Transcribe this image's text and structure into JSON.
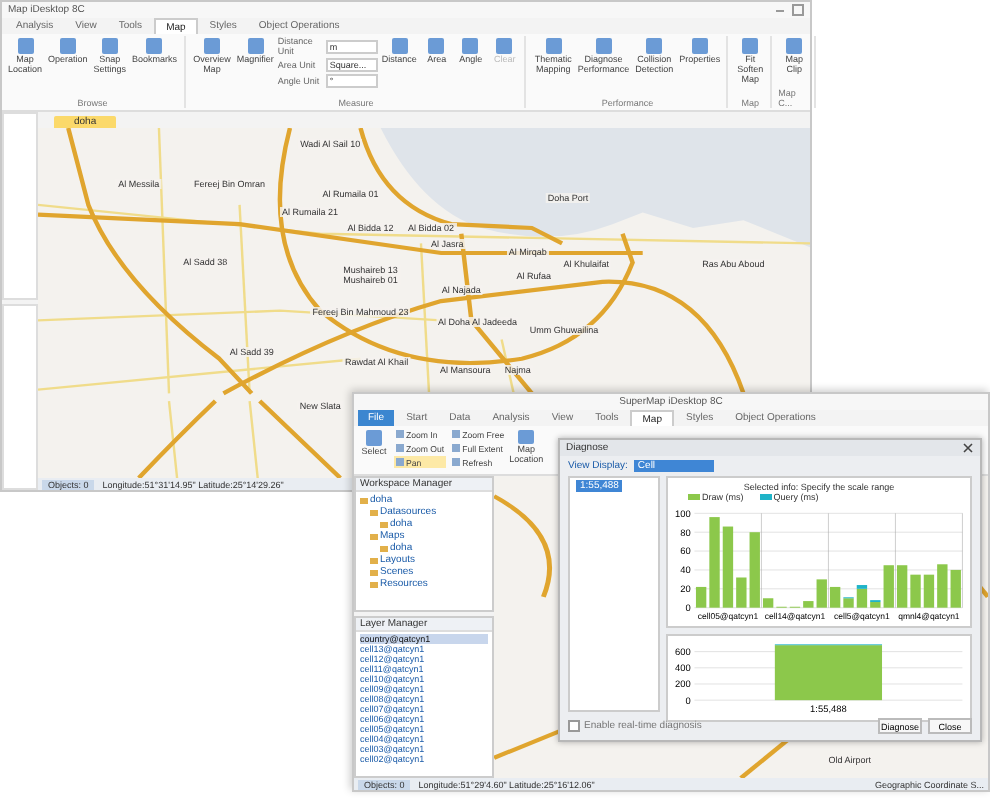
{
  "back_window": {
    "title": "Map iDesktop 8C",
    "tabs": [
      {
        "label": "Analysis",
        "selected": false
      },
      {
        "label": "View",
        "selected": false
      },
      {
        "label": "Tools",
        "selected": false
      },
      {
        "label": "Map",
        "selected": true
      },
      {
        "label": "Styles",
        "selected": false
      },
      {
        "label": "Object Operations",
        "selected": false
      }
    ],
    "ribbon_groups": [
      {
        "label": "Browse",
        "items": [
          {
            "kind": "button",
            "label": "Map Location",
            "disabled": false
          },
          {
            "kind": "button",
            "label": "Operation",
            "disabled": false
          },
          {
            "kind": "button",
            "label": "Snap Settings",
            "disabled": false
          },
          {
            "kind": "button",
            "label": "Bookmarks",
            "disabled": false
          }
        ]
      },
      {
        "label": "Measure",
        "items": [
          {
            "kind": "button",
            "label": "Overview Map",
            "disabled": false
          },
          {
            "kind": "button",
            "label": "Magnifier",
            "disabled": false
          },
          {
            "kind": "units",
            "fields": [
              {
                "label": "Distance Unit",
                "value": "m"
              },
              {
                "label": "Area Unit",
                "value": "Square..."
              },
              {
                "label": "Angle Unit",
                "value": "°"
              }
            ]
          },
          {
            "kind": "button",
            "label": "Distance",
            "disabled": false
          },
          {
            "kind": "button",
            "label": "Area",
            "disabled": false
          },
          {
            "kind": "button",
            "label": "Angle",
            "disabled": false
          },
          {
            "kind": "button",
            "label": "Clear",
            "disabled": true
          }
        ]
      },
      {
        "label": "Performance",
        "items": [
          {
            "kind": "button",
            "label": "Thematic Mapping",
            "disabled": false
          },
          {
            "kind": "button",
            "label": "Diagnose Performance",
            "disabled": false
          },
          {
            "kind": "button",
            "label": "Collision Detection",
            "disabled": false
          },
          {
            "kind": "button",
            "label": "Properties",
            "disabled": false
          }
        ]
      },
      {
        "label": "Map",
        "items": [
          {
            "kind": "button",
            "label": "Fit Soften Map",
            "disabled": false
          }
        ]
      },
      {
        "label": "Map C...",
        "items": [
          {
            "kind": "button",
            "label": "Map Clip",
            "disabled": false
          }
        ]
      }
    ],
    "document_tab": "doha",
    "map_labels": [
      "Wadi Al Sail 10",
      "Al Messila",
      "Fereej Bin Omran",
      "Al Rumaila 01",
      "Doha Port",
      "Al Rumaila 21",
      "Al Bidda 12",
      "Al Bidda 02",
      "Al Jasra",
      "Al Mirqab",
      "Al Sadd 38",
      "Al Khulaifat",
      "Ras Abu Aboud",
      "Mushaireb 13",
      "Al Rufaa",
      "Mushaireb 01",
      "Al Najada",
      "Fereej Bin Mahmoud 23",
      "Al Doha Al Jadeeda",
      "Umm Ghuwailina",
      "Al Sadd 39",
      "Rawdat Al Khail",
      "Al Mansoura",
      "Najma",
      "New Slata"
    ],
    "status_bar": {
      "objects": "Objects: 0",
      "coordinates": "Longitude:51°31'14.95\"  Latitude:25°14'29.26\""
    }
  },
  "front_window": {
    "title": "SuperMap iDesktop 8C",
    "tabs": [
      {
        "label": "File",
        "selected": false,
        "kind": "file"
      },
      {
        "label": "Start",
        "selected": false,
        "kind": "tab"
      },
      {
        "label": "Data",
        "selected": false,
        "kind": "tab"
      },
      {
        "label": "Analysis",
        "selected": false,
        "kind": "tab"
      },
      {
        "label": "View",
        "selected": false,
        "kind": "tab"
      },
      {
        "label": "Tools",
        "selected": false,
        "kind": "tab"
      },
      {
        "label": "Map",
        "selected": true,
        "kind": "tab"
      },
      {
        "label": "Styles",
        "selected": false,
        "kind": "tab"
      },
      {
        "label": "Object Operations",
        "selected": false,
        "kind": "tab"
      }
    ],
    "ribbon": [
      {
        "kind": "large",
        "label": "Select",
        "selected": false
      },
      {
        "kind": "small",
        "label": "Zoom In",
        "selected": false
      },
      {
        "kind": "small",
        "label": "Zoom Out",
        "selected": false
      },
      {
        "kind": "small",
        "label": "Pan",
        "selected": true
      },
      {
        "kind": "small",
        "label": "Zoom Free",
        "selected": false
      },
      {
        "kind": "small",
        "label": "Full Extent",
        "selected": false
      },
      {
        "kind": "small",
        "label": "Refresh",
        "selected": false
      },
      {
        "kind": "large",
        "label": "Map Location",
        "selected": false
      }
    ],
    "workspace_manager": {
      "title": "Workspace Manager",
      "tree": [
        {
          "label": "doha",
          "children": [
            {
              "label": "Datasources",
              "children": [
                {
                  "label": "doha"
                }
              ]
            },
            {
              "label": "Maps",
              "children": [
                {
                  "label": "doha"
                }
              ]
            },
            {
              "label": "Layouts"
            },
            {
              "label": "Scenes"
            },
            {
              "label": "Resources"
            }
          ]
        }
      ]
    },
    "layer_manager": {
      "title": "Layer Manager",
      "layers": [
        {
          "name": "country@qatcyn1",
          "selected": true
        },
        {
          "name": "cell13@qatcyn1",
          "selected": false
        },
        {
          "name": "cell12@qatcyn1",
          "selected": false
        },
        {
          "name": "cell11@qatcyn1",
          "selected": false
        },
        {
          "name": "cell10@qatcyn1",
          "selected": false
        },
        {
          "name": "cell09@qatcyn1",
          "selected": false
        },
        {
          "name": "cell08@qatcyn1",
          "selected": false
        },
        {
          "name": "cell07@qatcyn1",
          "selected": false
        },
        {
          "name": "cell06@qatcyn1",
          "selected": false
        },
        {
          "name": "cell05@qatcyn1",
          "selected": false
        },
        {
          "name": "cell04@qatcyn1",
          "selected": false
        },
        {
          "name": "cell03@qatcyn1",
          "selected": false
        },
        {
          "name": "cell02@qatcyn1",
          "selected": false
        }
      ]
    },
    "map_labels": [
      "Old Airport"
    ],
    "status_bar": {
      "objects": "Objects: 0",
      "coordinates": "Longitude:51°29'4.60\"  Latitude:25°16'12.06\"",
      "crs": "Geographic Coordinate S..."
    },
    "dialog": {
      "title": "Diagnose",
      "view_display_label": "View Display:",
      "view_display_value": "Cell",
      "tree_item": "1:55,488",
      "charts": [
        {
          "chart_data": {
            "type": "bar",
            "title": "Selected info: Specify the scale range",
            "stacked": true,
            "grid": true,
            "legend": "top-left",
            "categories": [
              null,
              null,
              "cell05@qatcyn1",
              null,
              null,
              null,
              null,
              "cell14@qatcyn1",
              null,
              null,
              null,
              null,
              "cell5@qatcyn1",
              null,
              null,
              null,
              null,
              "qmnl4@qatcyn1",
              null,
              null
            ],
            "yticks": [
              0,
              20,
              40,
              60,
              80,
              100
            ],
            "ylim": [
              0,
              100
            ],
            "series": [
              {
                "name": "Draw (ms)",
                "color": "#8cc84b",
                "values": [
                  22,
                  96,
                  86,
                  32,
                  80,
                  10,
                  1,
                  1,
                  7,
                  30,
                  22,
                  10,
                  20,
                  6,
                  45,
                  45,
                  35,
                  35,
                  46,
                  40
                ]
              },
              {
                "name": "Query (ms)",
                "color": "#1fb4c8",
                "values": [
                  0,
                  0,
                  0,
                  0,
                  0,
                  0,
                  0,
                  0,
                  0,
                  0,
                  0,
                  1,
                  4,
                  2,
                  0,
                  0,
                  0,
                  0,
                  0,
                  0
                ]
              }
            ]
          }
        },
        {
          "chart_data": {
            "type": "bar",
            "stacked": true,
            "grid": true,
            "categories": [
              "1:55,488"
            ],
            "yticks": [
              0,
              200,
              400,
              600
            ],
            "ylim": [
              0,
              700
            ],
            "series": [
              {
                "color": "#8cc84b",
                "values": [
                  680
                ]
              },
              {
                "color": "#1fb4c8",
                "values": [
                  10
                ]
              }
            ]
          }
        }
      ],
      "realtime_label": "Enable real-time diagnosis",
      "realtime_checked": false,
      "buttons": [
        "Diagnose",
        "Close"
      ]
    }
  }
}
